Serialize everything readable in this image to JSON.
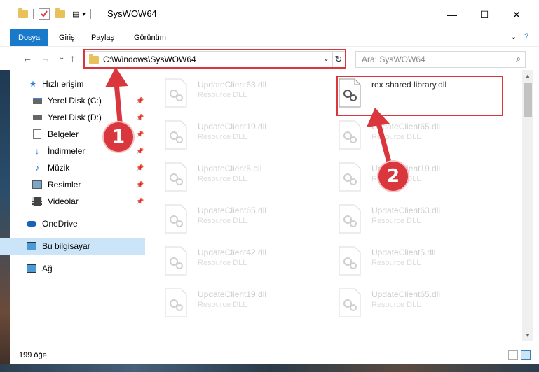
{
  "window": {
    "title": "SysWOW64",
    "minimize": "—",
    "maximize": "☐",
    "close": "✕"
  },
  "ribbon": {
    "tabs": [
      "Dosya",
      "Giriş",
      "Paylaş",
      "Görünüm"
    ],
    "expand": "⌄",
    "help": "?"
  },
  "address": {
    "path": "C:\\Windows\\SysWOW64",
    "dropdown": "⌄",
    "refresh": "↻"
  },
  "search": {
    "placeholder": "Ara: SysWOW64"
  },
  "nav": {
    "back": "←",
    "forward": "→",
    "recent": "⌄",
    "up": "↑"
  },
  "sidebar": {
    "items": [
      {
        "label": "Hızlı erişim",
        "icon": "star-icon",
        "pinned": false
      },
      {
        "label": "Yerel Disk (C:)",
        "icon": "drive-icon",
        "pinned": true
      },
      {
        "label": "Yerel Disk (D:)",
        "icon": "drive-icon",
        "pinned": true
      },
      {
        "label": "Belgeler",
        "icon": "documents-icon",
        "pinned": true
      },
      {
        "label": "İndirmeler",
        "icon": "download-icon",
        "pinned": true
      },
      {
        "label": "Müzik",
        "icon": "music-icon",
        "pinned": true
      },
      {
        "label": "Resimler",
        "icon": "pictures-icon",
        "pinned": true
      },
      {
        "label": "Videolar",
        "icon": "video-icon",
        "pinned": true
      },
      {
        "label": "OneDrive",
        "icon": "cloud-icon",
        "pinned": false
      },
      {
        "label": "Bu bilgisayar",
        "icon": "computer-icon",
        "pinned": false
      },
      {
        "label": "Ağ",
        "icon": "network-icon",
        "pinned": false
      }
    ]
  },
  "files": [
    {
      "name": "UpdateClient63.dll",
      "type": "Resource DLL"
    },
    {
      "name": "rex shared library.dll",
      "type": ""
    },
    {
      "name": "UpdateClient19.dll",
      "type": "Resource DLL"
    },
    {
      "name": "UpdateClient65.dll",
      "type": "Resource DLL"
    },
    {
      "name": "UpdateClient5.dll",
      "type": "Resource DLL"
    },
    {
      "name": "UpdateClient19.dll",
      "type": "Resource DLL"
    },
    {
      "name": "UpdateClient65.dll",
      "type": "Resource DLL"
    },
    {
      "name": "UpdateClient63.dll",
      "type": "Resource DLL"
    },
    {
      "name": "UpdateClient42.dll",
      "type": "Resource DLL"
    },
    {
      "name": "UpdateClient5.dll",
      "type": "Resource DLL"
    },
    {
      "name": "UpdateClient19.dll",
      "type": "Resource DLL"
    },
    {
      "name": "UpdateClient65.dll",
      "type": "Resource DLL"
    }
  ],
  "status": {
    "count": "199 öğe"
  },
  "callouts": [
    "1",
    "2"
  ],
  "colors": {
    "accent": "#1979ca",
    "highlight": "#d9363e",
    "selected": "#cce4f7"
  }
}
